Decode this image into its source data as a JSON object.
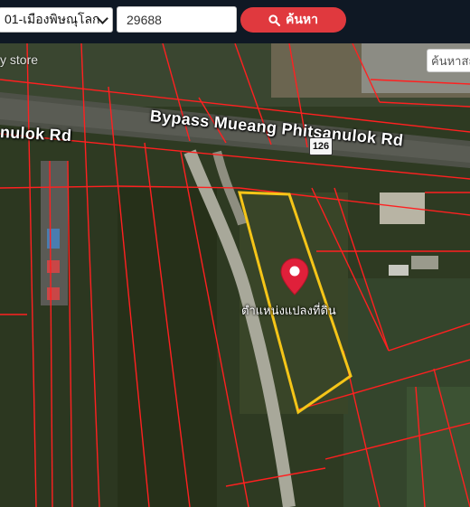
{
  "header": {
    "district_select": "01-เมืองพิษณุโลก",
    "parcel_number": "29688",
    "search_button_label": "ค้นหา"
  },
  "map": {
    "road_label_main": "Bypass Mueang Phitsanulok Rd",
    "road_label_left": "nulok Rd",
    "highway_shield": "126",
    "store_label": "y store",
    "search_chip": "ค้นหาสถ",
    "parcel_caption": "ตำแหน่งแปลงที่ดิน",
    "marker_color": "#e0203a",
    "parcel_outline_color": "#f5c518",
    "boundary_color": "#ff2020"
  }
}
